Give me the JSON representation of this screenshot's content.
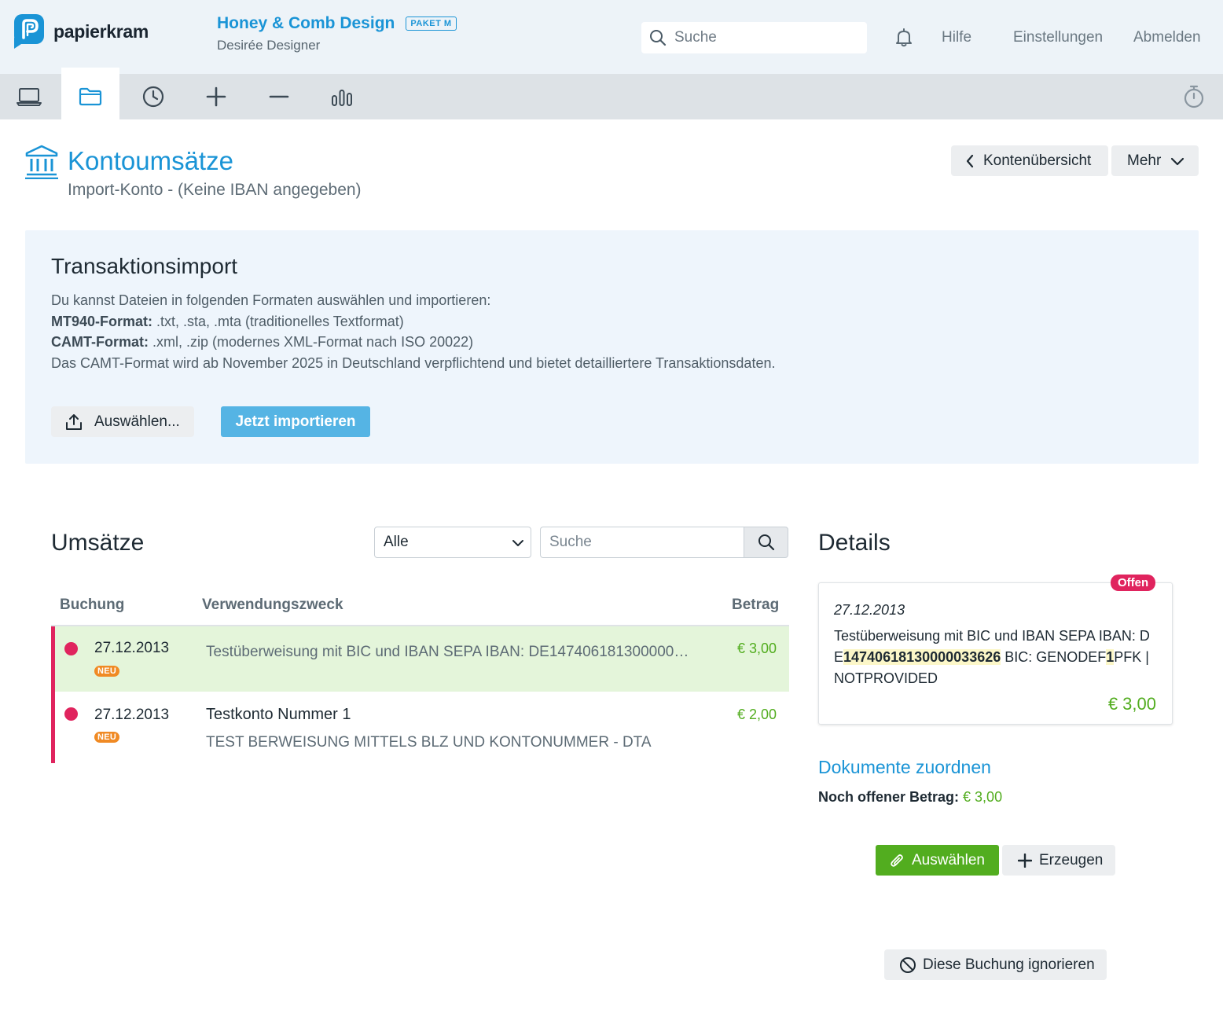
{
  "header": {
    "brand": "papierkram",
    "company_name": "Honey & Comb Design",
    "plan_badge": "PAKET M",
    "user_name": "Desirée Designer",
    "search_placeholder": "Suche",
    "links": {
      "help": "Hilfe",
      "settings": "Einstellungen",
      "logout": "Abmelden"
    }
  },
  "nav": {
    "items": [
      {
        "icon": "laptop-icon"
      },
      {
        "icon": "folder-icon",
        "active": true
      },
      {
        "icon": "clock-icon"
      },
      {
        "icon": "plus-icon"
      },
      {
        "icon": "minus-icon"
      },
      {
        "icon": "bar-chart-icon"
      }
    ],
    "right_icon": "stopwatch-icon"
  },
  "page": {
    "title": "Kontoumsätze",
    "subtitle": "Import-Konto - (Keine IBAN angegeben)",
    "back_button": "Kontenübersicht",
    "more_button": "Mehr"
  },
  "import": {
    "title": "Transaktionsimport",
    "intro": "Du kannst Dateien in folgenden Formaten auswählen und importieren:",
    "mt940_label": "MT940-Format:",
    "mt940_text": " .txt, .sta, .mta (traditionelles Textformat)",
    "camt_label": "CAMT-Format:",
    "camt_text": " .xml, .zip (modernes XML-Format nach ISO 20022)",
    "note": "Das CAMT-Format wird ab November 2025 in Deutschland verpflichtend und bietet detailliertere Transaktionsdaten.",
    "choose_button": "Auswählen...",
    "import_button": "Jetzt importieren"
  },
  "transactions": {
    "title": "Umsätze",
    "filter_value": "Alle",
    "search_placeholder": "Suche",
    "columns": {
      "booking": "Buchung",
      "purpose": "Verwendungszweck",
      "amount": "Betrag"
    },
    "rows": [
      {
        "date": "27.12.2013",
        "badge": "NEU",
        "purpose": "Testüberweisung mit BIC und IBAN SEPA IBAN: DE147406181300000…",
        "amount": "€ 3,00",
        "selected": true
      },
      {
        "date": "27.12.2013",
        "badge": "NEU",
        "purpose_title": "Testkonto Nummer 1",
        "purpose": "TEST BERWEISUNG MITTELS BLZ UND KONTONUMMER - DTA",
        "amount": "€ 2,00"
      }
    ]
  },
  "details": {
    "title": "Details",
    "status": "Offen",
    "date": "27.12.2013",
    "text_1": "Testüberweisung mit BIC und IBAN SEPA IBAN: D E",
    "text_hl_1": "14740618130000033626",
    "text_2": " BIC: GENODEF",
    "text_hl_2": "1",
    "text_3": "PFK | NOTPROVIDED",
    "amount": "€ 3,00",
    "assign_title": "Dokumente zuordnen",
    "open_label": "Noch offener Betrag:",
    "open_value": "€ 3,00",
    "choose_button": "Auswählen",
    "create_button": "Erzeugen",
    "ignore_button": "Diese Buchung ignorieren"
  },
  "colors": {
    "accent": "#1a94d6",
    "status_red": "#e0245e",
    "amount_green": "#52ad1f",
    "badge_orange": "#f08a24",
    "selected_row": "#e4f5da",
    "import_panel": "#eef5fc"
  }
}
